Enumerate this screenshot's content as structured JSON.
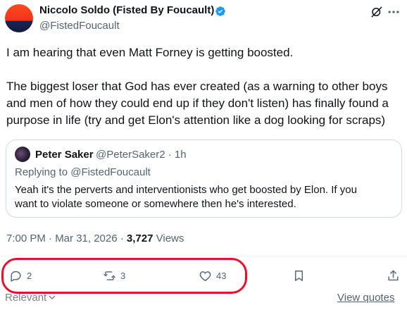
{
  "author": {
    "name": "Niccolo Soldo (Fisted By Foucault)",
    "handle": "@FistedFoucault"
  },
  "tweet": {
    "paragraphs": [
      [
        "I am hearing that even Matt Forney is getting boosted."
      ],
      [
        "The biggest loser that God has ever created (as a warning to other boys",
        "and men of how they could end up if they don't listen) has finally found a",
        "purpose in life (try and get Elon's attention like a dog looking for scraps)"
      ]
    ]
  },
  "quote": {
    "name": "Peter Saker",
    "meta": "@PeterSaker2 · 1h",
    "replying": "Replying to @FistedFoucault",
    "lines": [
      "Yeah it's the perverts and interventionists who get boosted by Elon.  If you",
      "want to violate someone or somewhere then he's interested."
    ]
  },
  "timestamp": {
    "datetime": "7:00 PM · Mar 31, 2026 · ",
    "views_count": "3,727",
    "views_label": " Views"
  },
  "actions": {
    "replies": "2",
    "reposts": "3",
    "likes": "43"
  },
  "footer": {
    "relevant": "Relevant",
    "view_quotes": "View quotes"
  },
  "icons": [
    "verified-badge-icon",
    "grok-icon",
    "more-icon",
    "reply-icon",
    "repost-icon",
    "like-icon",
    "bookmark-icon",
    "share-icon",
    "chevron-down-icon"
  ],
  "colors": {
    "text": "#0f1419",
    "secondary": "#536471",
    "verified": "#1d9bf0",
    "annotation": "#e8112d",
    "border": "#cfd9de"
  }
}
